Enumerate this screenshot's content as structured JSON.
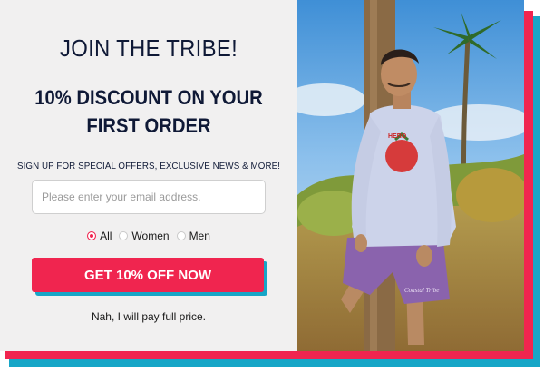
{
  "popup": {
    "join_title": "JOIN THE TRIBE!",
    "discount_title": "10% DISCOUNT ON YOUR FIRST ORDER",
    "signup_text": "SIGN UP FOR SPECIAL OFFERS, EXCLUSIVE NEWS & MORE!",
    "email": {
      "value": "",
      "placeholder": "Please enter your email address."
    },
    "gender_options": [
      {
        "label": "All",
        "selected": true
      },
      {
        "label": "Women",
        "selected": false
      },
      {
        "label": "Men",
        "selected": false
      }
    ],
    "cta_label": "GET 10% OFF NOW",
    "decline_label": "Nah, I will pay full price."
  },
  "photo": {
    "description_icon": "model-photo",
    "sweatshirt_print_text": "HERO",
    "shorts_print_text": "Coastal Tribe"
  },
  "colors": {
    "accent_red": "#f0254f",
    "accent_teal": "#17a6c7",
    "panel_bg": "#f1f0f0",
    "text_navy": "#0f1936"
  }
}
